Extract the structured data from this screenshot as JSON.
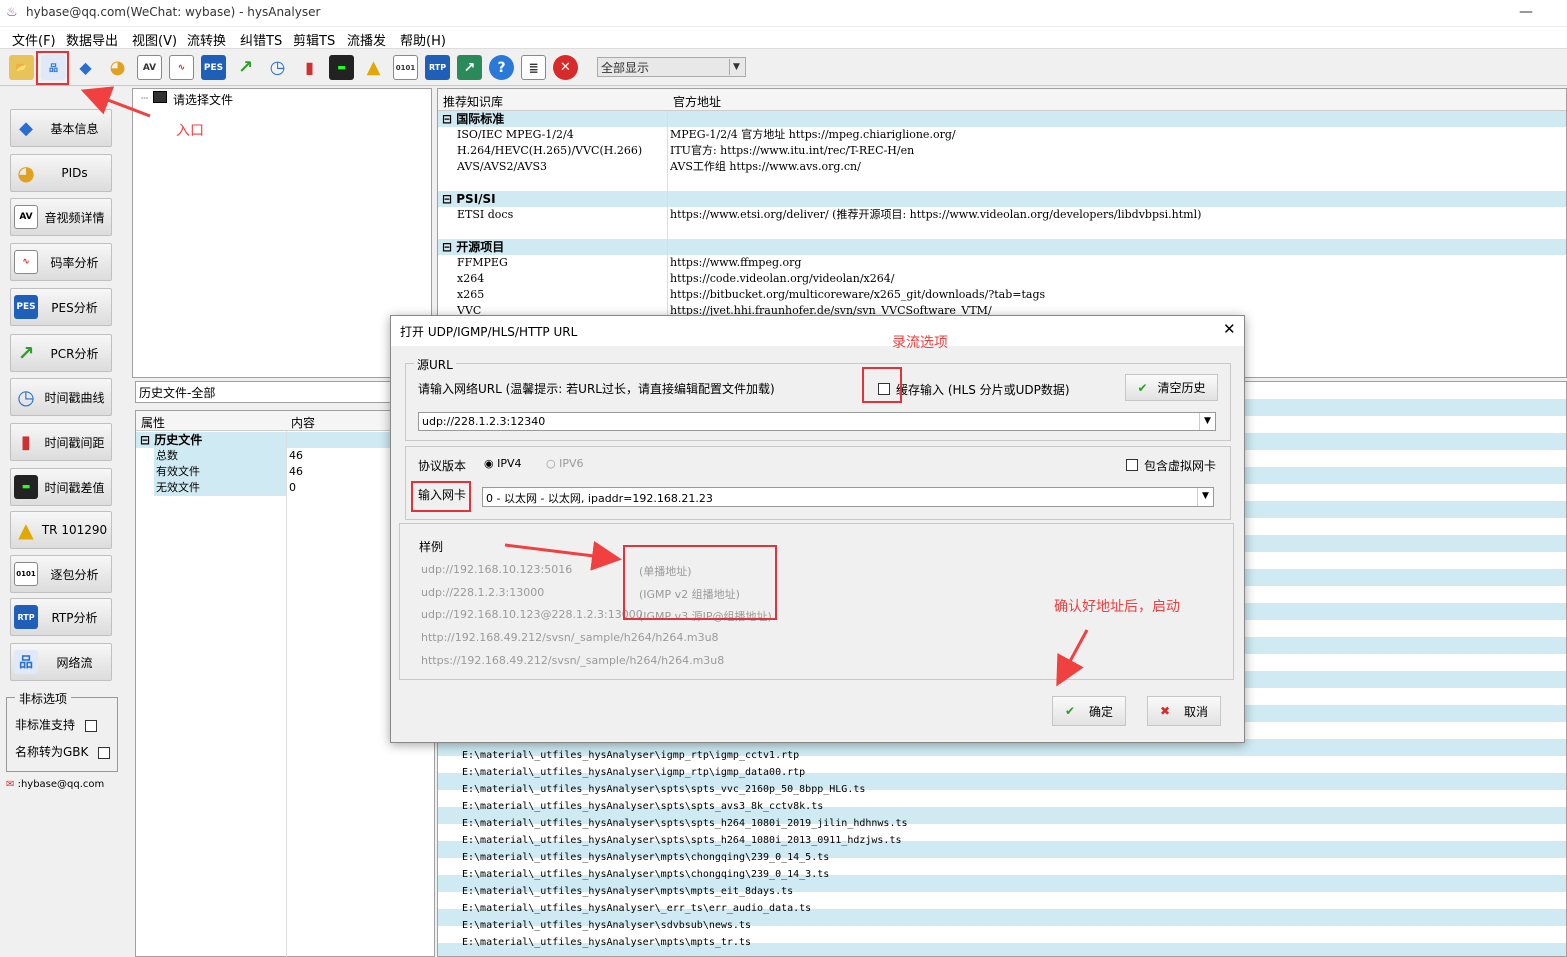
{
  "window": {
    "title": "hybase@qq.com(WeChat: wybase) - hysAnalyser"
  },
  "menu": [
    "文件(F)",
    "数据导出",
    "视图(V)",
    "流转换",
    "纠错TS",
    "剪辑TS",
    "流播发",
    "帮助(H)"
  ],
  "toolbar": {
    "filter_value": "全部显示"
  },
  "sidebar": {
    "items": [
      "基本信息",
      "PIDs",
      "音视频详情",
      "码率分析",
      "PES分析",
      "PCR分析",
      "时间戳曲线",
      "时间戳间距",
      "时间戳差值",
      "TR 101290",
      "逐包分析",
      "RTP分析",
      "网络流"
    ],
    "options_title": "非标选项",
    "opt_nonstd": "非标准支持",
    "opt_gbk": "名称转为GBK",
    "email": ":hybase@qq.com"
  },
  "file_tree": {
    "root": "请选择文件"
  },
  "history": {
    "filter": "历史文件-全部",
    "col_attr": "属性",
    "col_content": "内容",
    "group": "历史文件",
    "rows": [
      {
        "k": "总数",
        "v": "46"
      },
      {
        "k": "有效文件",
        "v": "46"
      },
      {
        "k": "无效文件",
        "v": "0"
      }
    ]
  },
  "kb": {
    "col1": "推荐知识库",
    "col2": "官方地址",
    "groups": [
      {
        "title": "国际标准",
        "rows": [
          {
            "a": "ISO/IEC MPEG-1/2/4",
            "b": "MPEG-1/2/4 官方地址 https://mpeg.chiariglione.org/"
          },
          {
            "a": "H.264/HEVC(H.265)/VVC(H.266)",
            "b": "ITU官方: https://www.itu.int/rec/T-REC-H/en"
          },
          {
            "a": "AVS/AVS2/AVS3",
            "b": "AVS工作组  https://www.avs.org.cn/"
          },
          {
            "a": "",
            "b": ""
          }
        ]
      },
      {
        "title": "PSI/SI",
        "rows": [
          {
            "a": "ETSI docs",
            "b": "https://www.etsi.org/deliver/ (推荐开源项目: https://www.videolan.org/developers/libdvbpsi.html)"
          },
          {
            "a": "",
            "b": ""
          }
        ]
      },
      {
        "title": "开源项目",
        "rows": [
          {
            "a": "FFMPEG",
            "b": "https://www.ffmpeg.org"
          },
          {
            "a": "x264",
            "b": "https://code.videolan.org/videolan/x264/"
          },
          {
            "a": "x265",
            "b": "https://bitbucket.org/multicoreware/x265_git/downloads/?tab=tags"
          },
          {
            "a": "VVC",
            "b": "https://jvet.hhi.fraunhofer.de/svn/svn_VVCSoftware_VTM/"
          }
        ]
      }
    ]
  },
  "recent_files": [
    "E:\\material\\_utfiles_hysAnalyser\\igmp_rtp\\igmp_cctv1.rtp",
    "E:\\material\\_utfiles_hysAnalyser\\igmp_rtp\\igmp_data00.rtp",
    "E:\\material\\_utfiles_hysAnalyser\\spts\\spts_vvc_2160p_50_8bpp_HLG.ts",
    "E:\\material\\_utfiles_hysAnalyser\\spts\\spts_avs3_8k_cctv8k.ts",
    "E:\\material\\_utfiles_hysAnalyser\\spts\\spts_h264_1080i_2019_jilin_hdhnws.ts",
    "E:\\material\\_utfiles_hysAnalyser\\spts\\spts_h264_1080i_2013_0911_hdzjws.ts",
    "E:\\material\\_utfiles_hysAnalyser\\mpts\\chongqing\\239_0_14_5.ts",
    "E:\\material\\_utfiles_hysAnalyser\\mpts\\chongqing\\239_0_14_3.ts",
    "E:\\material\\_utfiles_hysAnalyser\\mpts\\mpts_eit_8days.ts",
    "E:\\material\\_utfiles_hysAnalyser\\_err_ts\\err_audio_data.ts",
    "E:\\material\\_utfiles_hysAnalyser\\sdvbsub\\news.ts",
    "E:\\material\\_utfiles_hysAnalyser\\mpts\\mpts_tr.ts"
  ],
  "dialog": {
    "title": "打开 UDP/IGMP/HLS/HTTP URL",
    "src_legend": "源URL",
    "prompt": "请输入网络URL (温馨提示: 若URL过长，请直接编辑配置文件加载)",
    "cache_label": "缓存输入 (HLS 分片或UDP数据)",
    "clear_history": "清空历史",
    "url_value": "udp://228.1.2.3:12340",
    "proto_label": "协议版本",
    "ipv4": "IPV4",
    "ipv6": "IPV6",
    "virtual_nic": "包含虚拟网卡",
    "nic_label": "输入网卡",
    "nic_value": "0 - 以太网 - 以太网, ipaddr=192.168.21.23",
    "examples_legend": "样例",
    "examples": [
      "udp://192.168.10.123:5016",
      "udp://228.1.2.3:13000",
      "udp://192.168.10.123@228.1.2.3:13000",
      "http://192.168.49.212/svsn/_sample/h264/h264.m3u8",
      "https://192.168.49.212/svsn/_sample/h264/h264.m3u8"
    ],
    "example_notes": [
      "(单播地址)",
      "(IGMP v2 组播地址)",
      "(IGMP v3 源IP@组播地址)"
    ],
    "ok": "确定",
    "cancel": "取消"
  },
  "annotations": {
    "entry": "入口",
    "record": "录流选项",
    "confirm": "确认好地址后，启动"
  }
}
